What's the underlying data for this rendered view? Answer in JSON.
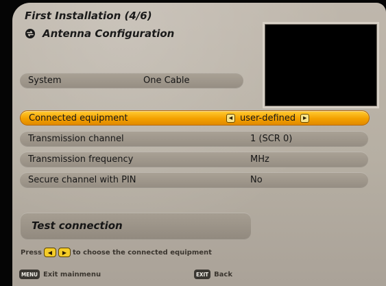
{
  "header": {
    "title": "First Installation (4/6)",
    "subtitle": "Antenna Configuration",
    "subtitle_icon": "swap-arrows-icon"
  },
  "system": {
    "label": "System",
    "value": "One Cable"
  },
  "menu": {
    "rows": [
      {
        "label": "Connected equipment",
        "value": "user-defined",
        "selected": true
      },
      {
        "label": "Transmission channel",
        "value": "1 (SCR 0)",
        "selected": false
      },
      {
        "label": "Transmission frequency",
        "value": "MHz",
        "selected": false
      },
      {
        "label": "Secure channel with PIN",
        "value": "No",
        "selected": false
      }
    ]
  },
  "test_connection": {
    "label": "Test connection"
  },
  "hint": {
    "prefix": "Press",
    "suffix": "to choose the connected equipment"
  },
  "footer": {
    "menu_key": "MENU",
    "menu_label": "Exit mainmenu",
    "exit_key": "EXIT",
    "exit_label": "Back"
  },
  "colors": {
    "panel": "#b6afa3",
    "selected_row": "#f3a000",
    "row": "#968e83",
    "preview": "#000000"
  }
}
